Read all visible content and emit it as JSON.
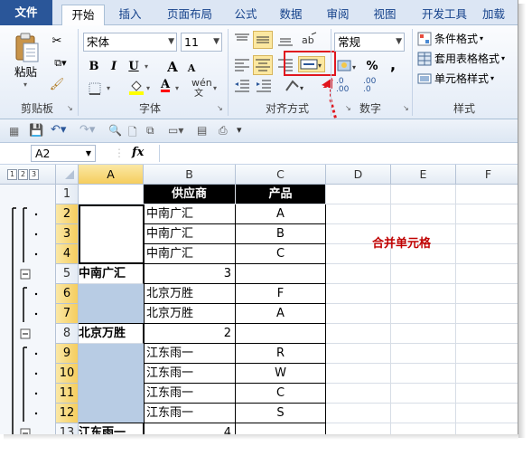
{
  "tabs": [
    "文件",
    "开始",
    "插入",
    "页面布局",
    "公式",
    "数据",
    "审阅",
    "视图",
    "开发工具",
    "加载"
  ],
  "active_tab": "开始",
  "clipboard": {
    "paste_label": "粘贴",
    "group_label": "剪贴板"
  },
  "font": {
    "name": "宋体",
    "size": "11",
    "bold": "B",
    "italic": "I",
    "underline": "U",
    "grow": "A",
    "shrink": "A",
    "wen": "wén",
    "wen_sub": "文",
    "fill_color": "#ffff00",
    "font_color": "#ff0000",
    "group_label": "字体"
  },
  "alignment": {
    "group_label": "对齐方式",
    "merge_highlight_color": "#e0161e"
  },
  "number": {
    "format": "常规",
    "percent": "%",
    "comma": ",",
    "inc_decimal": ".00",
    "dec_decimal": ".0",
    "inc_decimal_sub": "→.0",
    "dec_decimal_sub": "←.00",
    "group_label": "数字"
  },
  "styles": {
    "conditional": "条件格式",
    "table": "套用表格格式",
    "cell": "单元格样式",
    "group_label": "样式"
  },
  "formula_bar": {
    "name_box": "A2",
    "fx": "fx",
    "content": ""
  },
  "outline_levels": [
    "1",
    "2",
    "3"
  ],
  "columns": [
    "A",
    "B",
    "C",
    "D",
    "E",
    "F"
  ],
  "selected_column": "A",
  "rows": [
    {
      "num": "1",
      "a": "",
      "b": "供应商",
      "c": "产品",
      "header": true
    },
    {
      "num": "2",
      "a": "",
      "b": "中南广汇",
      "c": "A",
      "sel": true
    },
    {
      "num": "3",
      "a": "",
      "b": "中南广汇",
      "c": "B",
      "sel": true
    },
    {
      "num": "4",
      "a": "",
      "b": "中南广汇",
      "c": "C",
      "sel": true
    },
    {
      "num": "5",
      "a": "中南广汇",
      "b": "3",
      "c": "",
      "total": true
    },
    {
      "num": "6",
      "a": "",
      "b": "北京万胜",
      "c": "F",
      "sel": true
    },
    {
      "num": "7",
      "a": "",
      "b": "北京万胜",
      "c": "A",
      "sel": true
    },
    {
      "num": "8",
      "a": "北京万胜",
      "b": "2",
      "c": "",
      "total": true
    },
    {
      "num": "9",
      "a": "",
      "b": "江东雨一",
      "c": "R",
      "sel": true
    },
    {
      "num": "10",
      "a": "",
      "b": "江东雨一",
      "c": "W",
      "sel": true
    },
    {
      "num": "11",
      "a": "",
      "b": "江东雨一",
      "c": "C",
      "sel": true
    },
    {
      "num": "12",
      "a": "",
      "b": "江东雨一",
      "c": "S",
      "sel": true
    },
    {
      "num": "13",
      "a": "江东雨一",
      "b": "4",
      "c": "",
      "total": true
    }
  ],
  "annotation": {
    "text": "合并单元格",
    "color": "#c00000"
  },
  "colors": {
    "file_tab": "#2a5699",
    "selection_fill": "#b8cce4",
    "header_fill": "#000000"
  }
}
